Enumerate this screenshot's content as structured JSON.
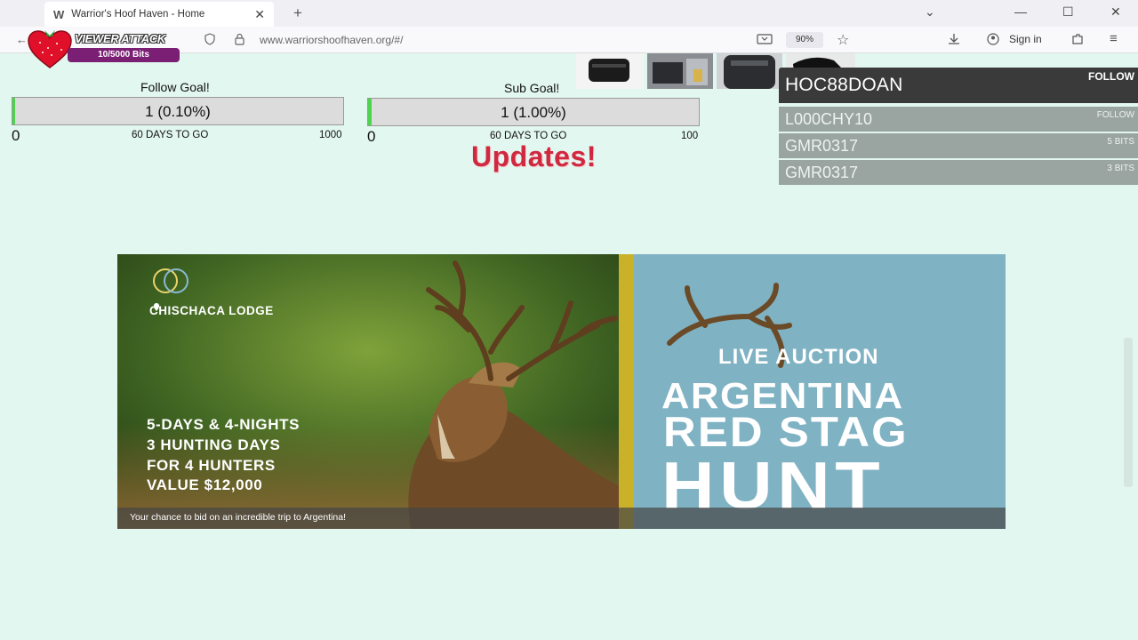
{
  "browser": {
    "tab_title": "Warrior's Hoof Haven - Home",
    "favicon": "W",
    "url": "www.warriorshoofhaven.org/#/",
    "zoom": "90%",
    "sign_in": "Sign in"
  },
  "viewer_attack": {
    "title": "VIEWER ATTACK",
    "progress": "10/5000 Bits"
  },
  "follow_goal": {
    "label": "Follow Goal!",
    "value": "1 (0.10%)",
    "percent": 0.1,
    "min": "0",
    "days": "60 DAYS TO GO",
    "max": "1000"
  },
  "sub_goal": {
    "label": "Sub Goal!",
    "value": "1 (1.00%)",
    "percent": 1.0,
    "min": "0",
    "days": "60 DAYS TO GO",
    "max": "100"
  },
  "updates_heading": "Updates!",
  "alerts": {
    "latest": {
      "name": "HOC88DOAN",
      "type": "FOLLOW"
    },
    "items": [
      {
        "name": "L000CHY10",
        "type": "FOLLOW"
      },
      {
        "name": "GMR0317",
        "type": "5 BITS"
      },
      {
        "name": "GMR0317",
        "type": "3 BITS"
      }
    ]
  },
  "banner": {
    "lodge": "CHISCHACA LODGE",
    "details": [
      "5-DAYS & 4-NIGHTS",
      "3 HUNTING DAYS",
      "FOR 4 HUNTERS",
      "VALUE $12,000"
    ],
    "live_auction": "LIVE AUCTION",
    "headline_1": "ARGENTINA",
    "headline_2": "RED STAG",
    "headline_3": "HUNT",
    "caption": "Your chance to bid on an incredible trip to Argentina!"
  },
  "colors": {
    "page_bg": "#e2f7ef",
    "updates_red": "#d0283f",
    "goal_fill": "#4ed34e",
    "banner_blue": "#7fb2c3",
    "banner_gold": "#c9b22a"
  }
}
